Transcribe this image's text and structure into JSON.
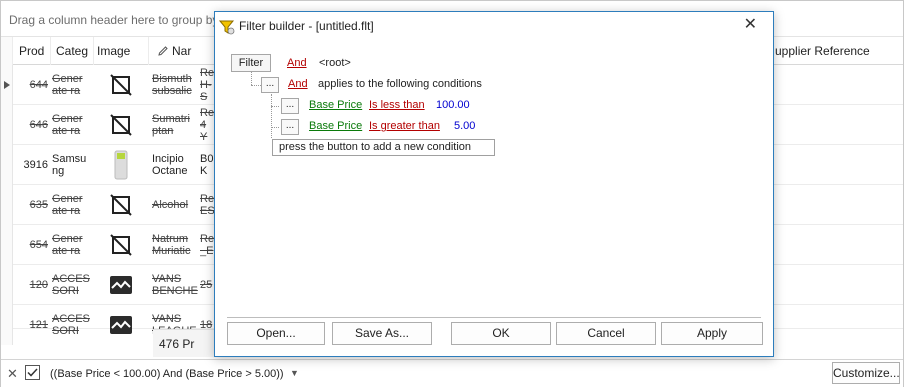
{
  "grid": {
    "group_panel_text": "Drag a column header here to group by",
    "columns": {
      "prod": "Prod",
      "category": "Categ",
      "image": "Image",
      "name": "Nar",
      "supplier_ref": "upplier Reference"
    },
    "rows": [
      {
        "id": "644",
        "category": "Gener ate ra",
        "name": "Bismuth subsalic",
        "extra": "Re H-S",
        "strike": true,
        "image": "no-image"
      },
      {
        "id": "646",
        "category": "Gener ate ra",
        "name": "Sumatri ptan",
        "extra": "Re 4 Y",
        "strike": true,
        "image": "no-image"
      },
      {
        "id": "3916",
        "category": "Samsu ng",
        "name": "Incipio Octane",
        "extra": "B0 K",
        "strike": false,
        "image": "phone-case"
      },
      {
        "id": "635",
        "category": "Gener ate ra",
        "name": "Alcohol",
        "extra": "Re ES",
        "strike": true,
        "image": "no-image"
      },
      {
        "id": "654",
        "category": "Gener ate ra",
        "name": "Natrum Muriatic",
        "extra": "Re _E",
        "strike": true,
        "image": "no-image"
      },
      {
        "id": "120",
        "category": "ACCES SORI",
        "name": "VANS BENCHE",
        "extra": "25",
        "strike": true,
        "image": "wave-image"
      },
      {
        "id": "121",
        "category": "ACCES SORI",
        "name": "VANS LEAGUE",
        "extra": "18",
        "strike": true,
        "image": "wave-image"
      }
    ],
    "footer_sum": "476 Pr"
  },
  "filter_bar": {
    "filter_text": "((Base Price < 100.00) And (Base Price > 5.00))",
    "customize_label": "Customize..."
  },
  "dialog": {
    "title": "Filter builder - [untitled.flt]",
    "filter_button": "Filter",
    "root_operator": "And",
    "root_label": "<root>",
    "dots": "...",
    "group_operator": "And",
    "group_label": "applies to the following conditions",
    "conditions": [
      {
        "field": "Base Price",
        "operator": "Is less than",
        "value": "100.00"
      },
      {
        "field": "Base Price",
        "operator": "Is greater than",
        "value": "5.00"
      }
    ],
    "add_condition": "press the button to add a new condition",
    "buttons": {
      "open": "Open...",
      "save_as": "Save As...",
      "ok": "OK",
      "cancel": "Cancel",
      "apply": "Apply"
    }
  },
  "colors": {
    "dialog_border": "#2d7dbc",
    "operator_red": "#b30000",
    "field_green": "#0a7a0a",
    "value_blue": "#0000d0"
  }
}
